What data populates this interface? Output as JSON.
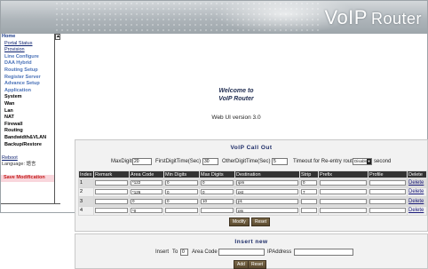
{
  "banner": {
    "title": "VoIP",
    "subtitle": "Router"
  },
  "sidebar": {
    "scroll_up": "▲",
    "scroll_down": "▼",
    "items": [
      {
        "label": "Home",
        "style": "home"
      },
      {
        "label": "Portal Status",
        "style": "link"
      },
      {
        "label": "Provision",
        "style": "link"
      },
      {
        "label": "Line Configure",
        "style": "blue"
      },
      {
        "label": "DAA Hybrid",
        "style": "blue"
      },
      {
        "label": "Routing Setup",
        "style": "blue"
      },
      {
        "label": "Register Server",
        "style": "blue"
      },
      {
        "label": "Advance Setup",
        "style": "blue"
      },
      {
        "label": "Application",
        "style": "blue"
      },
      {
        "label": "System",
        "style": "black"
      },
      {
        "label": "Wan",
        "style": "black"
      },
      {
        "label": "Lan",
        "style": "black"
      },
      {
        "label": "NAT",
        "style": "black"
      },
      {
        "label": "Firewall",
        "style": "black"
      },
      {
        "label": "Routing",
        "style": "black"
      },
      {
        "label": "Bandwidth&VLAN",
        "style": "black"
      },
      {
        "label": "Backup/Restore",
        "style": "black"
      },
      {
        "label": "",
        "style": "black"
      },
      {
        "label": "Reboot",
        "style": "plain"
      },
      {
        "label": "Language: 語言",
        "style": "lang"
      },
      {
        "label": "",
        "style": "black"
      },
      {
        "label": "Save Modification",
        "style": "save"
      }
    ]
  },
  "welcome": {
    "line1": "Welcome to",
    "line2": "VoIP Router",
    "version": "Web UI version 3.0"
  },
  "callout": {
    "title": "VoIP Call Out",
    "max_digits_label": "MaxDigits",
    "max_digits_value": "20",
    "first_digit_label": "FirstDigitTime(Sec)",
    "first_digit_value": "30",
    "other_digit_label": "OtherDigitTime(Sec)",
    "other_digit_value": "5",
    "timeout_label": "Timeout for Re-entry route",
    "timeout_value": "Disable",
    "timeout_unit": "second",
    "columns": [
      "Index",
      "Remark",
      "Area Code",
      "Min Digits",
      "Max Digits",
      "Destination",
      "Strip",
      "Prefix",
      "Profile",
      "Delete"
    ],
    "rows": [
      {
        "index": "1",
        "remark": "",
        "area_code": "*122",
        "min_digits": "0",
        "max_digits": "0",
        "destination": "ipm",
        "strip": "0",
        "prefix": "",
        "profile": "",
        "delete": "Delete"
      },
      {
        "index": "2",
        "remark": "",
        "area_code": "*126",
        "min_digits": "0",
        "max_digits": "0",
        "destination": "pst",
        "strip": "7",
        "prefix": "",
        "profile": "",
        "delete": "Delete"
      },
      {
        "index": "3",
        "remark": "",
        "area_code": "0",
        "min_digits": "0",
        "max_digits": "10",
        "destination": "p1",
        "strip": "",
        "prefix": "",
        "profile": "",
        "delete": "Delete"
      },
      {
        "index": "4",
        "remark": "",
        "area_code": "*0",
        "min_digits": "",
        "max_digits": "",
        "destination": "pts",
        "strip": "",
        "prefix": "",
        "profile": "",
        "delete": "Delete"
      }
    ],
    "modify_label": "Modify",
    "reset_label": "Reset"
  },
  "insert": {
    "title": "Insert new",
    "insert_label": "Insert",
    "to_label": "To",
    "to_value": "0",
    "area_code_label": "Area Code",
    "area_code_value": "",
    "ip_label": "IPAddress",
    "ip_value": "",
    "add_label": "Add",
    "reset_label": "Reset"
  }
}
